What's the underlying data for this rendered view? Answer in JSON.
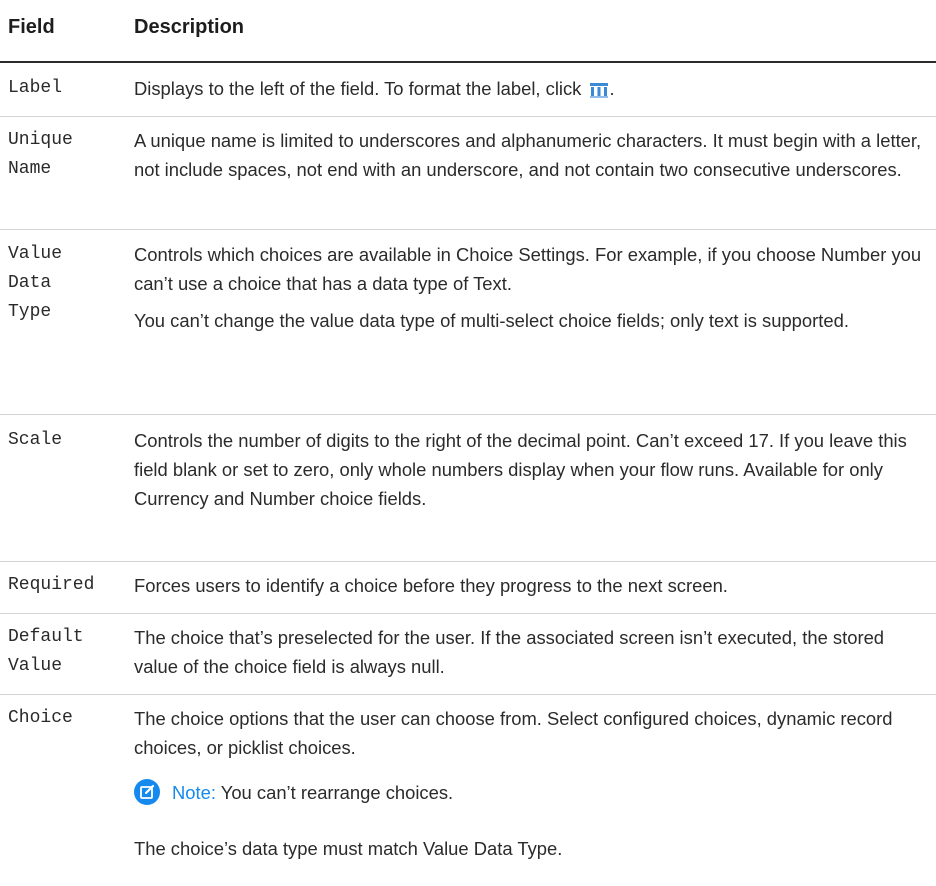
{
  "header": {
    "field": "Field",
    "description": "Description"
  },
  "rows": [
    {
      "field": "Label",
      "description_before_icon": "Displays to the left of the field. To format the label, click",
      "description_after_icon": "."
    },
    {
      "field_lines": [
        "Unique",
        "Name"
      ],
      "description": "A unique name is limited to underscores and alphanumeric characters. It must begin with a letter, not include spaces, not end with an underscore, and not contain two consecutive underscores."
    },
    {
      "field_lines": [
        "Value",
        "Data",
        "Type"
      ],
      "paragraphs": [
        "Controls which choices are available in Choice Settings. For example, if you choose Number you can’t use a choice that has a data type of Text.",
        "You can’t change the value data type of multi-select choice fields; only text is supported."
      ]
    },
    {
      "field": "Scale",
      "description": "Controls the number of digits to the right of the decimal point. Can’t exceed 17. If you leave this field blank or set to zero, only whole numbers display when your flow runs. Available for only Currency and Number choice fields."
    },
    {
      "field": "Required",
      "description": "Forces users to identify a choice before they progress to the next screen."
    },
    {
      "field_lines": [
        "Default",
        "Value"
      ],
      "description": "The choice that’s preselected for the user. If the associated screen isn’t executed, the stored value of the choice field is always null."
    },
    {
      "field": "Choice",
      "description": "The choice options that the user can choose from. Select configured choices, dynamic record choices, or picklist choices.",
      "note_label": "Note:",
      "note_text": "You can’t rearrange choices.",
      "after_note": "The choice’s data type must match Value Data Type."
    }
  ],
  "icons": {
    "format": "format-label-icon",
    "note": "note-edit-icon"
  },
  "colors": {
    "note_accent": "#1589ee",
    "rule": "#d4d4d4",
    "header_rule": "#2b2b2b"
  }
}
